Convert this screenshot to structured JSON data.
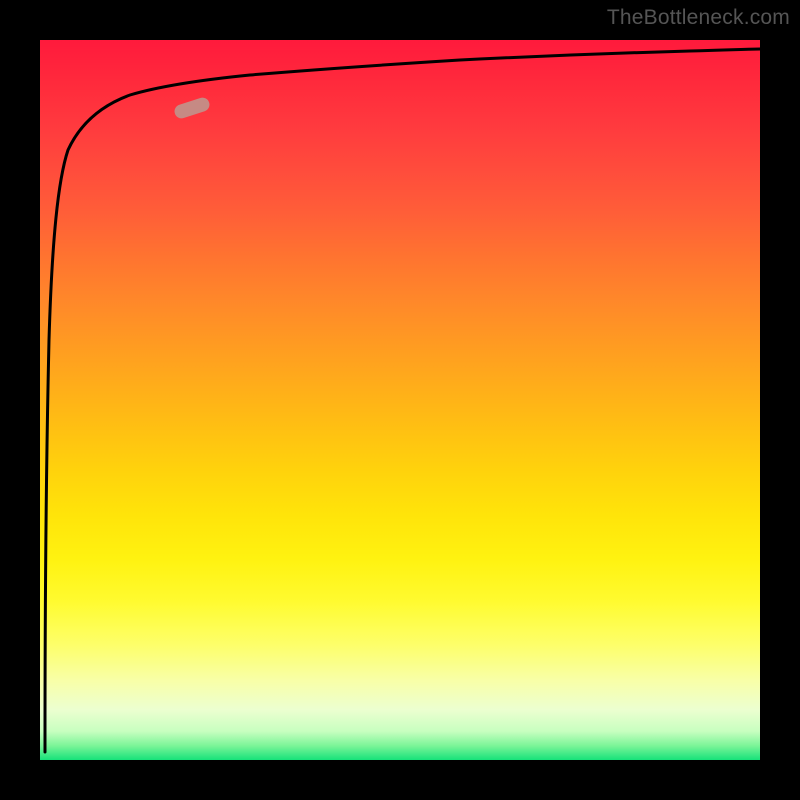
{
  "attribution": "TheBottleneck.com",
  "colors": {
    "gradient_top": "#ff1a3c",
    "gradient_mid_upper": "#ff8a2a",
    "gradient_mid": "#ffe010",
    "gradient_bottom": "#16e27a",
    "curve": "#000000",
    "marker": "#c68a84",
    "background": "#000000"
  },
  "chart_data": {
    "type": "line",
    "title": "",
    "xlabel": "",
    "ylabel": "",
    "xlim": [
      0,
      100
    ],
    "ylim": [
      0,
      100
    ],
    "grid": false,
    "legend": false,
    "series": [
      {
        "name": "curve",
        "x": [
          0.6,
          0.8,
          1.0,
          1.2,
          1.5,
          2.0,
          2.5,
          3.0,
          4.0,
          5.0,
          7.0,
          10.0,
          15.0,
          22.0,
          32.0,
          45.0,
          60.0,
          78.0,
          90.0,
          100.0
        ],
        "y": [
          1.0,
          40.0,
          62.0,
          73.0,
          80.0,
          85.0,
          87.5,
          89.0,
          90.5,
          91.5,
          92.5,
          93.5,
          94.5,
          95.5,
          96.5,
          97.2,
          97.8,
          98.4,
          98.8,
          99.0
        ]
      }
    ],
    "marker": {
      "series": "curve",
      "x": 22.0,
      "y": 90.0,
      "shape": "rounded-pill",
      "color": "#c68a84"
    }
  }
}
